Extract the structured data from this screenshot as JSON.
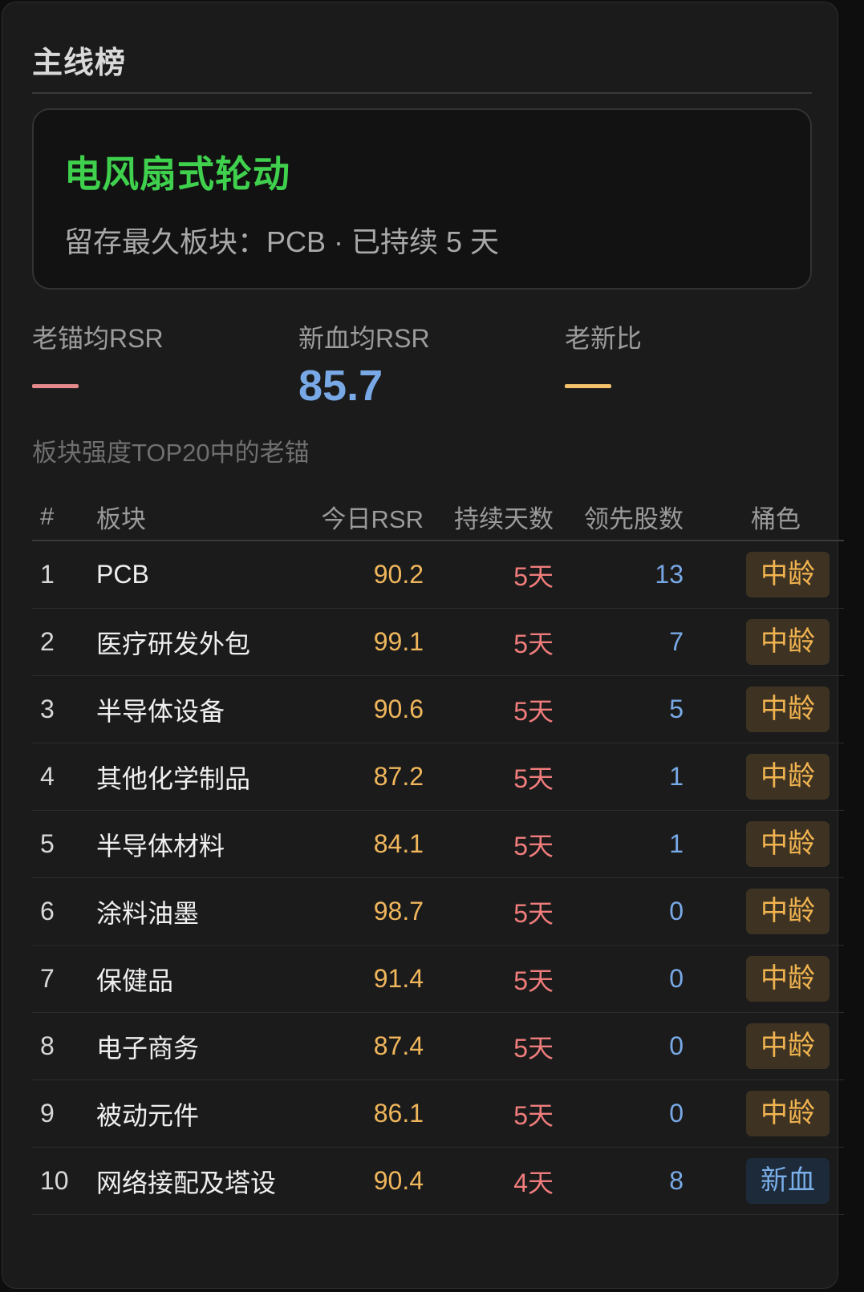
{
  "panel": {
    "title": "主线榜"
  },
  "hero": {
    "headline": "电风扇式轮动",
    "subline": "留存最久板块：PCB · 已持续 5 天"
  },
  "stats": [
    {
      "label": "老锚均RSR",
      "value": "—",
      "color": "#e58a8c"
    },
    {
      "label": "新血均RSR",
      "value": "85.7",
      "color": "#78a9e6"
    },
    {
      "label": "老新比",
      "value": "—",
      "color": "#f3c26b"
    }
  ],
  "section_label": "板块强度TOP20中的老锚",
  "table": {
    "headers": [
      "#",
      "板块",
      "今日RSR",
      "持续天数",
      "领先股数",
      "桶色"
    ],
    "rows": [
      {
        "idx": "1",
        "name": "PCB",
        "rsr": "90.2",
        "days": "5天",
        "lead": "13",
        "bucket": "中龄"
      },
      {
        "idx": "2",
        "name": "医疗研发外包",
        "rsr": "99.1",
        "days": "5天",
        "lead": "7",
        "bucket": "中龄"
      },
      {
        "idx": "3",
        "name": "半导体设备",
        "rsr": "90.6",
        "days": "5天",
        "lead": "5",
        "bucket": "中龄"
      },
      {
        "idx": "4",
        "name": "其他化学制品",
        "rsr": "87.2",
        "days": "5天",
        "lead": "1",
        "bucket": "中龄"
      },
      {
        "idx": "5",
        "name": "半导体材料",
        "rsr": "84.1",
        "days": "5天",
        "lead": "1",
        "bucket": "中龄"
      },
      {
        "idx": "6",
        "name": "涂料油墨",
        "rsr": "98.7",
        "days": "5天",
        "lead": "0",
        "bucket": "中龄"
      },
      {
        "idx": "7",
        "name": "保健品",
        "rsr": "91.4",
        "days": "5天",
        "lead": "0",
        "bucket": "中龄"
      },
      {
        "idx": "8",
        "name": "电子商务",
        "rsr": "87.4",
        "days": "5天",
        "lead": "0",
        "bucket": "中龄"
      },
      {
        "idx": "9",
        "name": "被动元件",
        "rsr": "86.1",
        "days": "5天",
        "lead": "0",
        "bucket": "中龄"
      },
      {
        "idx": "10",
        "name": "网络接配及塔设",
        "rsr": "90.4",
        "days": "4天",
        "lead": "8",
        "bucket": "新血"
      }
    ]
  },
  "colors": {
    "headline_green": "#3fd14d",
    "rsr_orange": "#f0b65c",
    "days_red": "#f07c7c",
    "lead_blue": "#78a9e6",
    "badge_mid_bg": "#3e3322",
    "badge_new_bg": "#1d2a3a"
  }
}
